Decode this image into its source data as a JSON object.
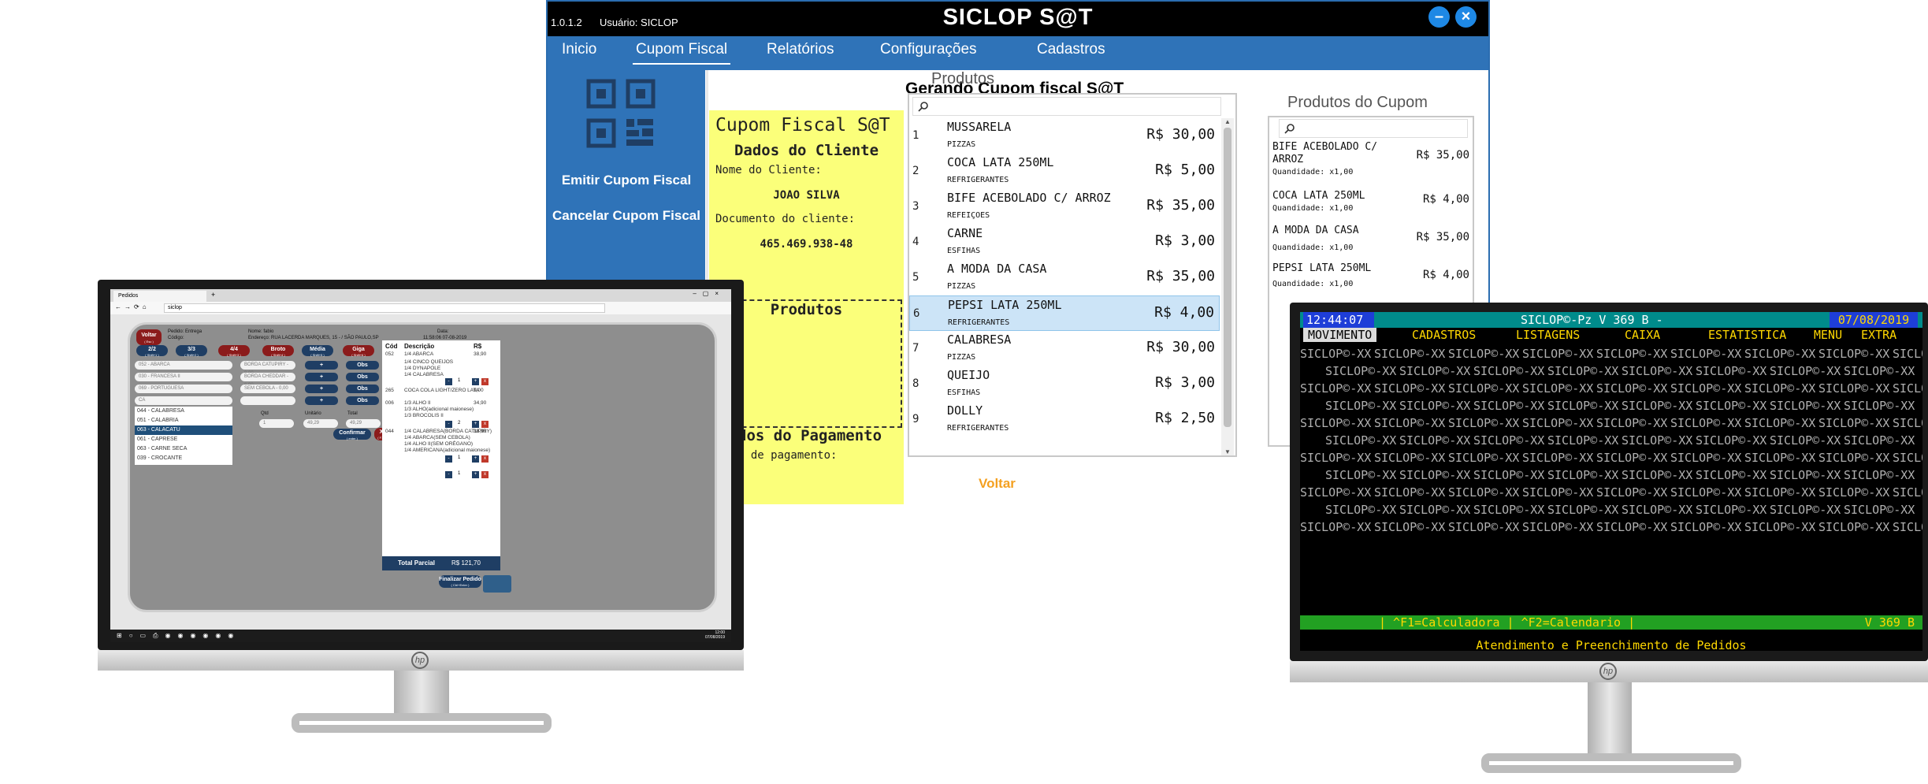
{
  "sat": {
    "version": "1.0.1.2",
    "user": "Usuário: SICLOP",
    "title": "SICLOP S@T",
    "menu": [
      "Inicio",
      "Cupom Fiscal",
      "Relatórios",
      "Configurações",
      "Cadastros"
    ],
    "side": {
      "emit": "Emitir Cupom Fiscal",
      "cancel": "Cancelar Cupom Fiscal"
    },
    "heading": "Gerando Cupom fiscal S@T",
    "client_panel": {
      "title": "Cupom Fiscal S@T",
      "section": "Dados do Cliente",
      "name_label": "Nome do Cliente:",
      "name_value": "JOAO SILVA",
      "doc_label": "Documento do cliente:",
      "doc_value": "465.469.938-48",
      "products": "Produtos",
      "payment": "dos do Pagamento",
      "payment_label": "a de pagamento:"
    },
    "products_title": "Produtos",
    "products": [
      {
        "n": "1",
        "name": "MUSSARELA",
        "cat": "PIZZAS",
        "price": "R$ 30,00"
      },
      {
        "n": "2",
        "name": "COCA LATA 250ML",
        "cat": "REFRIGERANTES",
        "price": "R$ 5,00"
      },
      {
        "n": "3",
        "name": "BIFE ACEBOLADO C/ ARROZ",
        "cat": "REFEIÇOES",
        "price": "R$ 35,00"
      },
      {
        "n": "4",
        "name": "CARNE",
        "cat": "ESFIHAS",
        "price": "R$ 3,00"
      },
      {
        "n": "5",
        "name": "A MODA DA CASA",
        "cat": "PIZZAS",
        "price": "R$ 35,00"
      },
      {
        "n": "6",
        "name": "PEPSI LATA 250ML",
        "cat": "REFRIGERANTES",
        "price": "R$ 4,00"
      },
      {
        "n": "7",
        "name": "CALABRESA",
        "cat": "PIZZAS",
        "price": "R$ 30,00"
      },
      {
        "n": "8",
        "name": "QUEIJO",
        "cat": "ESFIHAS",
        "price": "R$ 3,00"
      },
      {
        "n": "9",
        "name": "DOLLY",
        "cat": "REFRIGERANTES",
        "price": "R$ 2,50"
      }
    ],
    "cupom_title": "Produtos do Cupom",
    "cupom": [
      {
        "name": "BIFE ACEBOLADO C/ ARROZ",
        "qty": "Quandidade: x1,00",
        "price": "R$ 35,00"
      },
      {
        "name": "COCA LATA 250ML",
        "qty": "Quandidade: x1,00",
        "price": "R$ 4,00"
      },
      {
        "name": "A MODA DA CASA",
        "qty": "Quandidade: x1,00",
        "price": "R$ 35,00"
      },
      {
        "name": "PEPSI LATA 250ML",
        "qty": "Quandidade: x1,00",
        "price": "R$ 4,00"
      }
    ],
    "back": "Voltar"
  },
  "pdv": {
    "tab": "Pedidos",
    "url": "siclop",
    "back": "Voltar",
    "back_sub": "( Esc )",
    "pedido": "Pedido: Entrega",
    "codigo": "Código:",
    "nome": "Nome: fabio",
    "endereco": "Endereço: RUA LACERDA MARQUES, 15 - / SÃO PAULO,SP",
    "data_label": "Data:",
    "data_value": "11:58:06 07-08-2019",
    "sizes": [
      {
        "label": "2/2",
        "sub": "( Shift+1 )"
      },
      {
        "label": "3/3",
        "sub": "( Shift+2 )"
      },
      {
        "label": "4/4",
        "sub": "( Shift+3 )"
      },
      {
        "label": "Broto",
        "sub": "( Shift+4 )"
      },
      {
        "label": "Média",
        "sub": "( Shift+5 )"
      },
      {
        "label": "Giga",
        "sub": "( Shift+6 )"
      }
    ],
    "flavors": [
      "052 - ABARCA",
      "030 - FRANCESA II",
      "069 - PORTUGUESA",
      "CA"
    ],
    "borders": [
      "BORDA CATUPIRY - 8,00",
      "BORDA CHEDDAR - 6,00",
      "SEM CEBOLA - 0,00",
      ""
    ],
    "plus": "+",
    "obs": "Obs",
    "dropdown": [
      "044 - CALABRESA",
      "051 - CALABRIA",
      "063 - CALACATU",
      "061 - CAPRESE",
      "063 - CARNE SECA",
      "039 - CROCANTE"
    ],
    "qtd_label": "Qtd",
    "qtd_value": "1",
    "unit_label": "Unitário",
    "unit_value": "49,29",
    "total_label": "Total",
    "total_value": "49,29",
    "confirm": "Confirmar",
    "confirm_sub": "( enter )",
    "cancel": "X",
    "cancel_sub": "( F1 )",
    "order_headers": [
      "Cód",
      "Descrição",
      "R$"
    ],
    "order_rows": [
      {
        "code": "052",
        "desc": "1/4 ABARCA",
        "price": "38,90"
      },
      {
        "code": "",
        "desc": "1/4 CINCO QUEIJOS",
        "price": ""
      },
      {
        "code": "",
        "desc": "1/4 DYNAPOLE",
        "price": ""
      },
      {
        "code": "",
        "desc": "1/4 CALABRESA",
        "price": ""
      },
      {
        "code": "265",
        "desc": "COCA COLA LIGHT/ZERO LATA",
        "price": "9,00"
      },
      {
        "code": "006",
        "desc": "1/3 ALHO II",
        "price": "34,90"
      },
      {
        "code": "",
        "desc": "1/3 ALHO(adicional maionese)",
        "price": ""
      },
      {
        "code": "",
        "desc": "1/3 BROCOLIS II",
        "price": ""
      },
      {
        "code": "044",
        "desc": "1/4 CALABRESA(BORDA CATUPIRY)",
        "price": "38,90"
      },
      {
        "code": "",
        "desc": "1/4 ABARCA(SEM CEBOLA)",
        "price": ""
      },
      {
        "code": "",
        "desc": "1/4 ALHO II(SEM ORÉGANO)",
        "price": ""
      },
      {
        "code": "",
        "desc": "1/4 AMERICANA(adicional maionese)",
        "price": ""
      }
    ],
    "qty_markers": [
      "1",
      "2",
      "1",
      "1"
    ],
    "total_parcial_label": "Total Parcial",
    "total_parcial_value": "R$ 121,70",
    "finalizar": "Finalizar Pedido",
    "finalizar_sub": "( Ctrl+Enter )",
    "tray_time": "12:00",
    "tray_date": "07/08/2019"
  },
  "term": {
    "time": "12:44:07",
    "title": "SICLOP©-Pz V 369 B -",
    "date": "07/08/2019",
    "menu": [
      "MOVIMENTO",
      "CADASTROS",
      "LISTAGENS",
      "CAIXA",
      "ESTATISTICA",
      "MENU",
      "EXTRA"
    ],
    "watermark": "SICLOP©-XX",
    "fkeys": "| ^F1=Calculadora | ^F2=Calendario |",
    "version": "V 369 B",
    "footer": "Atendimento e Preenchimento de Pedidos"
  },
  "colors": {
    "sat_blue": "#2f73b8",
    "yellow_panel": "#fbff7a",
    "pdv_navy": "#1f3e64",
    "pdv_red": "#8b1b1b",
    "term_yellow": "#ffd800",
    "term_green": "#22a022"
  }
}
